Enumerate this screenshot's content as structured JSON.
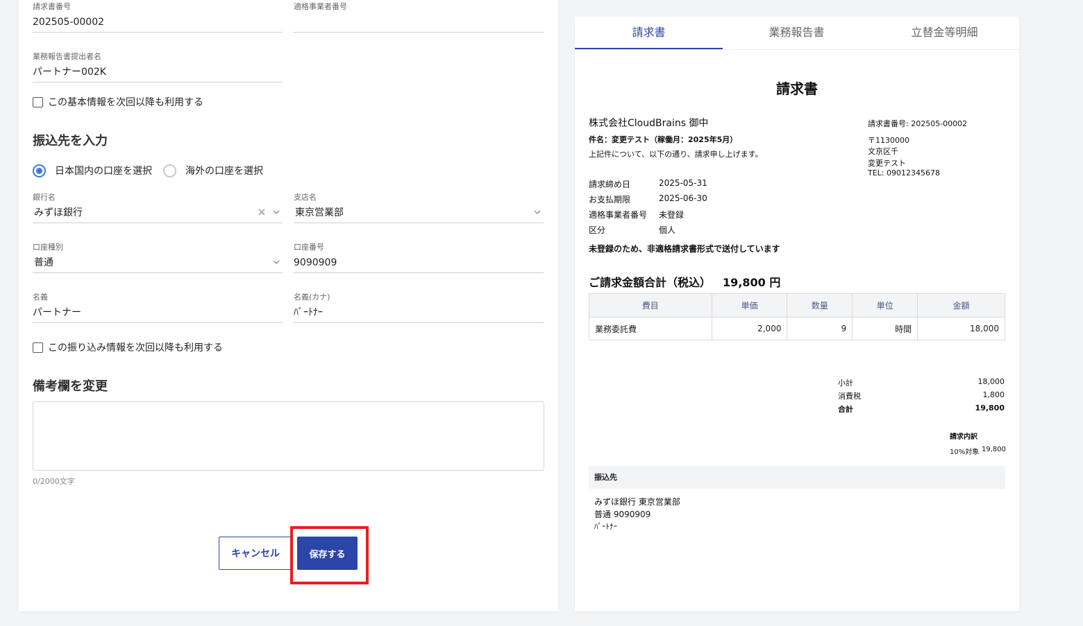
{
  "form": {
    "invoice_number": {
      "label": "請求書番号",
      "value": "202505-00002"
    },
    "qualified_number": {
      "label": "適格事業者番号",
      "value": ""
    },
    "submitter": {
      "label": "業務報告書提出者名",
      "value": "パートナー002K"
    },
    "reuse_basic_info": "この基本情報を次回以降も利用する",
    "bank_section_title": "振込先を入力",
    "radio_domestic": "日本国内の口座を選択",
    "radio_overseas": "海外の口座を選択",
    "bank_name": {
      "label": "銀行名",
      "value": "みずほ銀行"
    },
    "branch_name": {
      "label": "支店名",
      "value": "東京営業部"
    },
    "account_type": {
      "label": "口座種別",
      "value": "普通"
    },
    "account_number": {
      "label": "口座番号",
      "value": "9090909"
    },
    "holder_name": {
      "label": "名義",
      "value": "パートナー"
    },
    "holder_kana": {
      "label": "名義(カナ)",
      "value": "ﾊﾟｰﾄﾅｰ"
    },
    "reuse_bank_info": "この振り込み情報を次回以降も利用する",
    "remarks_title": "備考欄を変更",
    "remarks_counter": "0/2000文字",
    "cancel_label": "キャンセル",
    "save_label": "保存する"
  },
  "preview": {
    "tabs": [
      "請求書",
      "業務報告書",
      "立替金等明細"
    ],
    "title": "請求書",
    "recipient": "株式会社CloudBrains 御中",
    "subject": "件名：変更テスト（稼働月：2025年5月）",
    "intro": "上記件について、以下の通り、請求申し上げます。",
    "issuer": {
      "invoice_no": "請求書番号: 202505-00002",
      "postal": "〒1130000",
      "address": "文京区千",
      "name": "変更テスト",
      "tel": "TEL: 09012345678"
    },
    "meta": [
      {
        "label": "請求締め日",
        "value": "2025-05-31"
      },
      {
        "label": "お支払期限",
        "value": "2025-06-30"
      },
      {
        "label": "適格事業者番号",
        "value": "未登録"
      },
      {
        "label": "区分",
        "value": "個人"
      }
    ],
    "notice": "未登録のため、非適格請求書形式で送付しています",
    "total_label": "ご請求金額合計（税込）",
    "total_value": "19,800 円",
    "table_headers": [
      "費目",
      "単価",
      "数量",
      "単位",
      "金額"
    ],
    "table_rows": [
      [
        "業務委託費",
        "2,000",
        "9",
        "時間",
        "18,000"
      ]
    ],
    "summary": [
      {
        "label": "小計",
        "value": "18,000"
      },
      {
        "label": "消費税",
        "value": "1,800"
      },
      {
        "label": "合計",
        "value": "19,800"
      }
    ],
    "breakdown_title": "請求内訳",
    "breakdown_label": "10%対象",
    "breakdown_value": "19,800",
    "transfer_title": "振込先",
    "transfer_bank": "みずほ銀行 東京営業部",
    "transfer_account": "普通 9090909",
    "transfer_holder": "ﾊﾟｰﾄﾅｰ"
  },
  "colors": {
    "accent": "#2b45a8",
    "highlight": "#e5201c",
    "radio": "#3b7ddd"
  },
  "icons": [
    "chevron-down-icon",
    "clear-icon"
  ]
}
